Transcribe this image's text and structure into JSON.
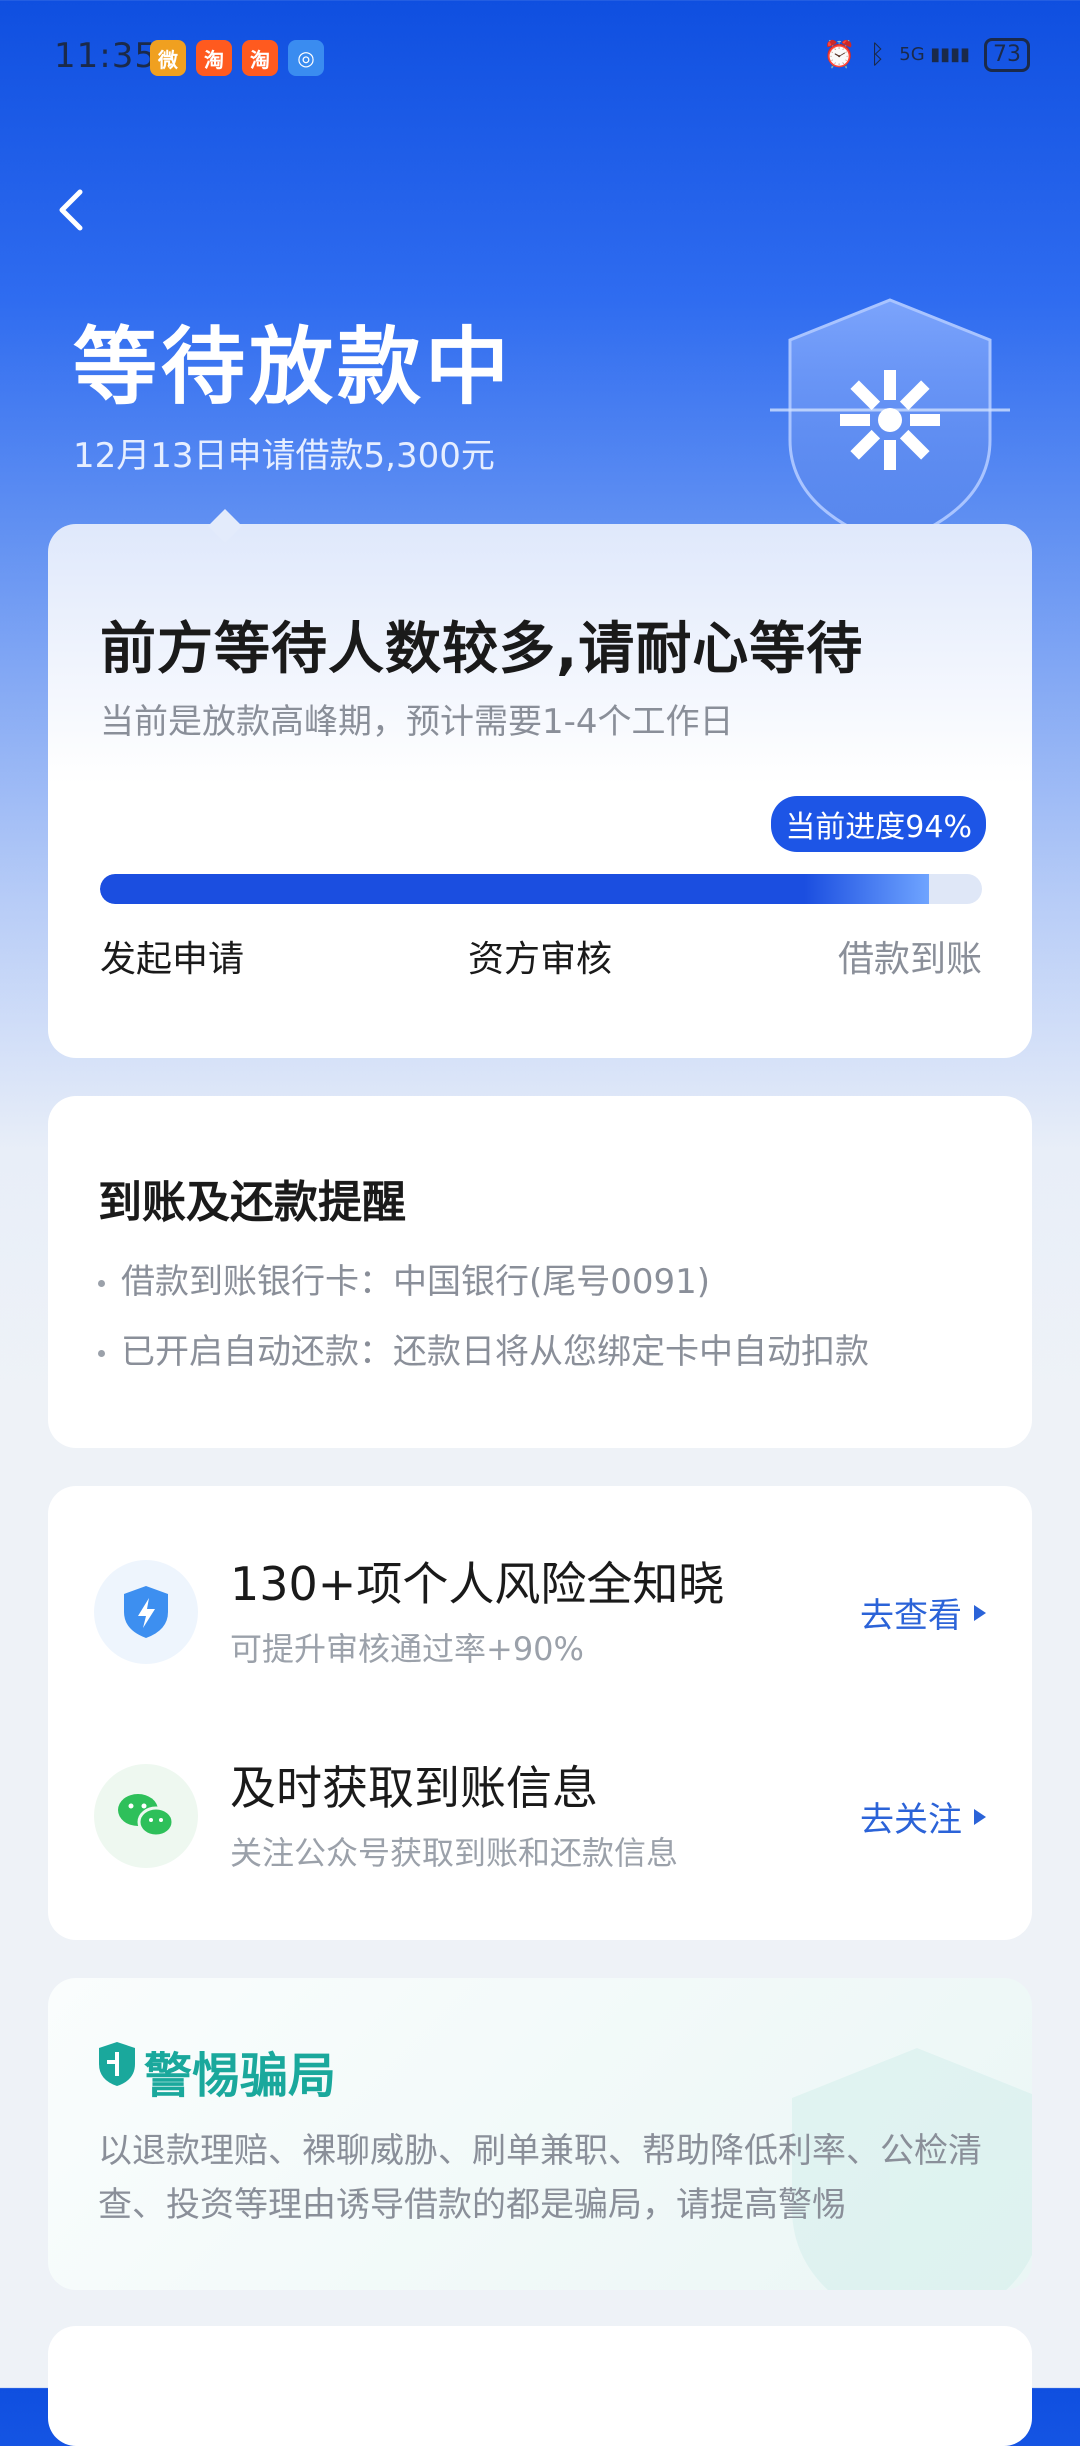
{
  "status_bar": {
    "time": "11:35",
    "apps": [
      {
        "name": "weibo",
        "glyph": "微",
        "color": "#f0a020"
      },
      {
        "name": "taobao",
        "glyph": "淘",
        "color": "#ff5a1f"
      },
      {
        "name": "taobao",
        "glyph": "淘",
        "color": "#ff5a1f"
      },
      {
        "name": "browser",
        "glyph": "◎",
        "color": "#3a8cf0"
      }
    ],
    "signal": "5G",
    "battery": "73"
  },
  "header": {
    "title": "等待放款中",
    "subtitle": "12月13日申请借款5,300元"
  },
  "progress_card": {
    "title": "前方等待人数较多,请耐心等待",
    "subtitle": "当前是放款高峰期，预计需要1-4个工作日",
    "badge": "当前进度94%",
    "progress_percent": 94,
    "steps": [
      "发起申请",
      "资方审核",
      "借款到账"
    ]
  },
  "reminder_card": {
    "title": "到账及还款提醒",
    "lines": [
      "借款到账银行卡：中国银行(尾号0091)",
      "已开启自动还款：还款日将从您绑定卡中自动扣款"
    ]
  },
  "services": [
    {
      "title": "130+项个人风险全知晓",
      "subtitle": "可提升审核通过率+90%",
      "action": "去查看",
      "icon": "lightning-shield-icon"
    },
    {
      "title": "及时获取到账信息",
      "subtitle": "关注公众号获取到账和还款信息",
      "action": "去关注",
      "icon": "wechat-icon"
    }
  ],
  "fraud_card": {
    "title": "警惕骗局",
    "text": "以退款理赔、裸聊威胁、刷单兼职、帮助降低利率、公检清查、投资等理由诱导借款的都是骗局，请提高警惕"
  },
  "colors": {
    "primary": "#1d55e6",
    "link": "#2b63d8",
    "fraud_green": "#1aa89c"
  }
}
